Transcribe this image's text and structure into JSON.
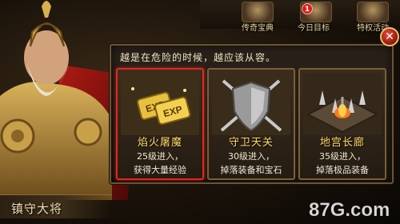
{
  "top_menu": {
    "items": [
      {
        "label": "传奇宝典",
        "icon": "book-icon"
      },
      {
        "label": "今日目标",
        "icon": "target-icon",
        "badge": "1"
      },
      {
        "label": "特权活动",
        "icon": "treasure-chest-icon"
      }
    ]
  },
  "hero": {
    "name": "镇守大将",
    "icon": "general-portrait"
  },
  "dialog": {
    "prompt": "越是在危险的时候，越应该从容。",
    "close_icon": "close-icon",
    "cards": [
      {
        "title": "焰火屠魔",
        "level_req": "25级进入，",
        "reward": "获得大量经验",
        "icon": "exp-tokens-icon",
        "art_labels": [
          "EXP",
          "EXP"
        ],
        "selected": true
      },
      {
        "title": "守卫天关",
        "level_req": "30级进入，",
        "reward": "掉落装备和宝石",
        "icon": "shield-crossed-swords-icon",
        "selected": false
      },
      {
        "title": "地宫长廊",
        "level_req": "35级进入，",
        "reward": "掉落极品装备",
        "icon": "spiked-trap-fire-icon",
        "selected": false
      }
    ]
  },
  "watermark": {
    "text": "87G.com",
    "icon": "site-logo"
  },
  "colors": {
    "selected_border": "#e0281d",
    "card_title": "#ffd86a",
    "panel_border": "#6a5434"
  }
}
